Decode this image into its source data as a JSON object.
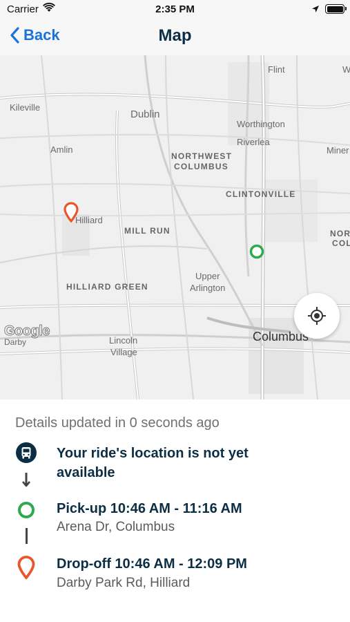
{
  "status_bar": {
    "carrier": "Carrier",
    "time": "2:35 PM"
  },
  "nav": {
    "back_label": "Back",
    "title": "Map"
  },
  "map": {
    "labels": {
      "flint": "Flint",
      "w": "W",
      "kileville": "Kileville",
      "dublin": "Dublin",
      "worthington": "Worthington",
      "riverlea": "Riverlea",
      "amlin": "Amlin",
      "northwest": "NORTHWEST",
      "columbus_nw": "COLUMBUS",
      "miner": "Miner",
      "clintonville": "CLINTONVILLE",
      "hilliard": "Hilliard",
      "mill_run": "MILL RUN",
      "nor": "NOR",
      "col": "COL",
      "hilliard_green": "HILLIARD GREEN",
      "upper": "Upper",
      "arlington": "Arlington",
      "lincoln": "Lincoln",
      "village": "Village",
      "darby": "Darby",
      "columbus": "Columbus"
    },
    "google_mark": "Google",
    "colors": {
      "pickup": "#2fa84f",
      "dropoff": "#e8572c"
    }
  },
  "details": {
    "updated_text": "Details updated in 0 seconds ago",
    "ride_line1": "Your ride's location is not yet",
    "ride_line2": "available",
    "pickup_title": "Pick-up 10:46 AM - 11:16 AM",
    "pickup_address": "Arena Dr, Columbus",
    "dropoff_title": "Drop-off 10:46 AM - 12:09 PM",
    "dropoff_address": "Darby Park Rd, Hilliard"
  }
}
